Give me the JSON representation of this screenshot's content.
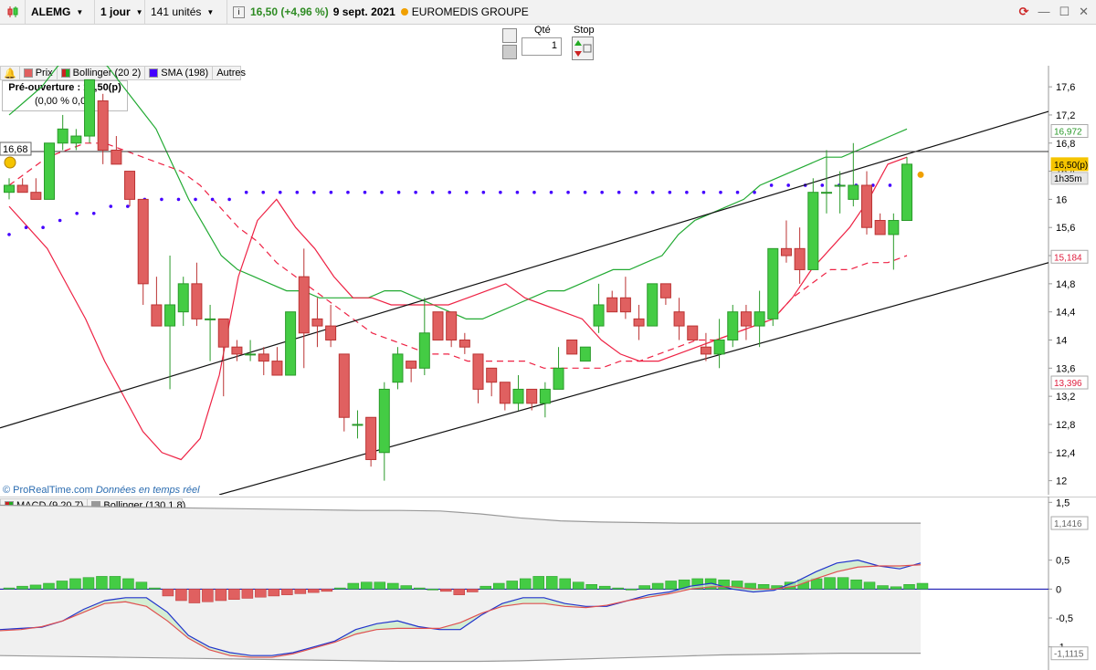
{
  "toolbar": {
    "ticker": "ALEMG",
    "period": "1 jour",
    "units": "141 unités",
    "price_change": "16,50 (+4,96 %)",
    "date": "9 sept. 2021",
    "company": "EUROMEDIS GROUPE"
  },
  "order": {
    "qty_label": "Qté",
    "qty_value": "1",
    "stop_label": "Stop"
  },
  "legend": {
    "prix": "Prix",
    "bollinger": "Bollinger (20 2)",
    "sma": "SMA (198)",
    "autres": "Autres"
  },
  "preouverture": {
    "line1": "Pré-ouverture : 16,50(p)",
    "line2": "(0,00 %  0,00)"
  },
  "hline_label": "16,68",
  "copyright": {
    "brand": "© ProRealTime.com",
    "note": "Données en temps réel"
  },
  "macd_legend": {
    "macd": "MACD (9 20 7)",
    "bollinger": "Bollinger (130 1.8)"
  },
  "colors": {
    "up": "#44cc44",
    "down": "#e06060",
    "sma": "#4400ff",
    "band": "#ff2244",
    "accent": "#f0c000"
  },
  "chart_data": [
    {
      "type": "candlestick",
      "title": "ALEMG",
      "ylim": [
        11.8,
        17.9
      ],
      "y_ticks": [
        "17,6",
        "17,2",
        "16,8",
        "16,4",
        "16",
        "15,6",
        "15,2",
        "14,8",
        "14,4",
        "14",
        "13,6",
        "13,2",
        "12,8",
        "12,4",
        "12"
      ],
      "price_tags": {
        "last": "16,50(p)",
        "time": "1h35m",
        "bb_upper": "16,972",
        "bb_lower": "15,184",
        "bb_lower_left": "13,396"
      },
      "candles": [
        [
          16.1,
          16.3,
          16.0,
          16.2
        ],
        [
          16.2,
          16.3,
          16.1,
          16.1
        ],
        [
          16.1,
          16.3,
          16.0,
          16.0
        ],
        [
          16.0,
          16.8,
          16.0,
          16.8
        ],
        [
          16.8,
          17.2,
          16.7,
          17.0
        ],
        [
          16.8,
          17.0,
          16.7,
          16.9
        ],
        [
          16.9,
          17.7,
          16.8,
          17.7
        ],
        [
          17.4,
          17.5,
          16.5,
          16.7
        ],
        [
          16.7,
          16.9,
          16.5,
          16.5
        ],
        [
          16.4,
          16.4,
          15.9,
          16.0
        ],
        [
          16.0,
          16.0,
          14.5,
          14.8
        ],
        [
          14.5,
          14.9,
          14.2,
          14.2
        ],
        [
          14.2,
          15.2,
          13.3,
          14.5
        ],
        [
          14.4,
          14.9,
          14.2,
          14.8
        ],
        [
          14.8,
          15.1,
          14.2,
          14.3
        ],
        [
          14.3,
          14.5,
          13.7,
          14.3
        ],
        [
          14.3,
          14.3,
          13.2,
          13.9
        ],
        [
          13.9,
          14.0,
          13.7,
          13.8
        ],
        [
          13.8,
          14.0,
          13.7,
          13.8
        ],
        [
          13.8,
          13.9,
          13.5,
          13.7
        ],
        [
          13.7,
          13.9,
          13.5,
          13.5
        ],
        [
          13.5,
          14.4,
          13.5,
          14.4
        ],
        [
          14.9,
          15.3,
          13.6,
          14.1
        ],
        [
          14.3,
          14.6,
          13.9,
          14.2
        ],
        [
          14.2,
          14.5,
          13.9,
          14.0
        ],
        [
          13.8,
          13.8,
          12.7,
          12.9
        ],
        [
          12.8,
          13.0,
          12.6,
          12.8
        ],
        [
          12.9,
          12.9,
          12.2,
          12.3
        ],
        [
          12.4,
          13.4,
          12.0,
          13.3
        ],
        [
          13.4,
          13.9,
          13.3,
          13.8
        ],
        [
          13.7,
          13.7,
          13.4,
          13.6
        ],
        [
          13.6,
          14.6,
          13.5,
          14.1
        ],
        [
          14.4,
          14.4,
          14.0,
          14.0
        ],
        [
          14.4,
          14.4,
          13.9,
          14.0
        ],
        [
          14.0,
          14.1,
          13.8,
          13.9
        ],
        [
          13.8,
          13.8,
          13.1,
          13.3
        ],
        [
          13.6,
          13.6,
          13.2,
          13.4
        ],
        [
          13.4,
          13.4,
          13.0,
          13.1
        ],
        [
          13.1,
          13.5,
          13.0,
          13.3
        ],
        [
          13.3,
          13.3,
          13.0,
          13.1
        ],
        [
          13.1,
          13.4,
          12.9,
          13.3
        ],
        [
          13.3,
          13.9,
          13.3,
          13.6
        ],
        [
          14.0,
          14.0,
          13.8,
          13.8
        ],
        [
          13.7,
          13.9,
          13.7,
          13.9
        ],
        [
          14.2,
          14.8,
          14.1,
          14.5
        ],
        [
          14.6,
          14.7,
          14.4,
          14.4
        ],
        [
          14.6,
          14.9,
          14.3,
          14.4
        ],
        [
          14.3,
          14.5,
          14.0,
          14.2
        ],
        [
          14.2,
          14.8,
          14.2,
          14.8
        ],
        [
          14.8,
          14.8,
          14.5,
          14.6
        ],
        [
          14.4,
          14.6,
          14.0,
          14.2
        ],
        [
          14.2,
          14.2,
          14.0,
          14.0
        ],
        [
          13.9,
          14.1,
          13.7,
          13.8
        ],
        [
          13.8,
          14.3,
          13.6,
          14.0
        ],
        [
          14.0,
          14.5,
          13.9,
          14.4
        ],
        [
          14.4,
          14.5,
          14.0,
          14.2
        ],
        [
          14.2,
          14.7,
          13.9,
          14.4
        ],
        [
          14.3,
          15.3,
          14.2,
          15.3
        ],
        [
          15.3,
          15.7,
          15.1,
          15.2
        ],
        [
          15.3,
          15.6,
          14.8,
          15.0
        ],
        [
          15.0,
          16.3,
          15.0,
          16.1
        ],
        [
          16.1,
          16.7,
          15.8,
          16.1
        ],
        [
          16.2,
          16.4,
          15.8,
          16.2
        ],
        [
          16.0,
          16.8,
          15.9,
          16.2
        ],
        [
          16.2,
          16.4,
          15.5,
          15.6
        ],
        [
          15.7,
          15.8,
          15.5,
          15.5
        ],
        [
          15.5,
          15.8,
          15.0,
          15.7
        ],
        [
          15.7,
          16.6,
          15.8,
          16.5
        ]
      ],
      "bb_upper_line": [
        17.2,
        17.4,
        17.6,
        17.9,
        18.0,
        18.0,
        17.9,
        17.6,
        17.3,
        17.0,
        16.5,
        16.0,
        15.6,
        15.2,
        15.0,
        14.9,
        14.8,
        14.7,
        14.7,
        14.6,
        14.6,
        14.6,
        14.6,
        14.7,
        14.7,
        14.6,
        14.5,
        14.4,
        14.3,
        14.3,
        14.4,
        14.5,
        14.6,
        14.7,
        14.7,
        14.8,
        14.9,
        15.0,
        15.0,
        15.1,
        15.2,
        15.5,
        15.7,
        15.8,
        15.9,
        16.0,
        16.2,
        16.3,
        16.4,
        16.5,
        16.6,
        16.6,
        16.7,
        16.8,
        16.9,
        17.0
      ],
      "bb_mid_line": [
        16.2,
        16.4,
        16.6,
        16.7,
        16.8,
        16.8,
        16.7,
        16.6,
        16.5,
        16.4,
        16.2,
        15.9,
        15.6,
        15.4,
        15.1,
        14.9,
        14.7,
        14.5,
        14.3,
        14.1,
        14.0,
        13.9,
        13.8,
        13.8,
        13.7,
        13.7,
        13.7,
        13.7,
        13.6,
        13.6,
        13.6,
        13.6,
        13.7,
        13.7,
        13.8,
        13.9,
        14.0,
        14.0,
        14.1,
        14.2,
        14.3,
        14.6,
        14.8,
        15.0,
        15.0,
        15.1,
        15.1,
        15.2
      ],
      "sma_line": [
        15.5,
        15.6,
        15.6,
        15.7,
        15.8,
        15.8,
        15.9,
        15.9,
        16.0,
        16.0,
        16.0,
        16.0,
        16.0,
        16.0,
        16.1,
        16.1,
        16.1,
        16.1,
        16.1,
        16.1,
        16.1,
        16.1,
        16.1,
        16.1,
        16.1,
        16.1,
        16.1,
        16.1,
        16.1,
        16.1,
        16.1,
        16.1,
        16.1,
        16.1,
        16.1,
        16.1,
        16.1,
        16.1,
        16.1,
        16.1,
        16.1,
        16.1,
        16.1,
        16.1,
        16.1,
        16.2,
        16.2,
        16.2,
        16.2,
        16.2,
        16.2,
        16.2,
        16.2,
        16.2
      ],
      "hline": 16.68
    },
    {
      "type": "macd",
      "title": "MACD (9 20 7)",
      "ylim": [
        -1.4,
        1.6
      ],
      "y_ticks": [
        "1,5",
        "0,5",
        "0",
        "-0,5",
        "-1"
      ],
      "band_upper_tag": "1,1416",
      "band_lower_tag": "-1,1115",
      "histogram": [
        0.02,
        0.05,
        0.07,
        0.1,
        0.14,
        0.18,
        0.2,
        0.22,
        0.22,
        0.18,
        0.12,
        0.02,
        -0.12,
        -0.2,
        -0.24,
        -0.22,
        -0.2,
        -0.18,
        -0.16,
        -0.14,
        -0.12,
        -0.1,
        -0.08,
        -0.06,
        -0.04,
        0.02,
        0.1,
        0.12,
        0.12,
        0.1,
        0.06,
        0.02,
        0.0,
        -0.04,
        -0.1,
        -0.05,
        0.05,
        0.1,
        0.14,
        0.18,
        0.22,
        0.22,
        0.18,
        0.12,
        0.08,
        0.05,
        0.02,
        0.0,
        0.06,
        0.1,
        0.14,
        0.16,
        0.18,
        0.18,
        0.16,
        0.14,
        0.1,
        0.08,
        0.06,
        0.12,
        0.16,
        0.18,
        0.2,
        0.2,
        0.16,
        0.12,
        0.06,
        0.04,
        0.08,
        0.1
      ],
      "macd_line": [
        -0.7,
        -0.68,
        -0.66,
        -0.55,
        -0.35,
        -0.2,
        -0.15,
        -0.15,
        -0.4,
        -0.8,
        -1.0,
        -1.1,
        -1.15,
        -1.15,
        -1.1,
        -1.0,
        -0.9,
        -0.7,
        -0.6,
        -0.55,
        -0.65,
        -0.7,
        -0.7,
        -0.45,
        -0.25,
        -0.15,
        -0.15,
        -0.25,
        -0.3,
        -0.3,
        -0.2,
        -0.1,
        -0.05,
        0.05,
        0.1,
        0.0,
        -0.05,
        -0.02,
        0.12,
        0.3,
        0.45,
        0.5,
        0.4,
        0.35,
        0.45
      ],
      "signal_line": [
        -0.72,
        -0.7,
        -0.65,
        -0.55,
        -0.4,
        -0.25,
        -0.22,
        -0.3,
        -0.55,
        -0.85,
        -1.05,
        -1.15,
        -1.18,
        -1.18,
        -1.12,
        -1.02,
        -0.92,
        -0.78,
        -0.7,
        -0.68,
        -0.68,
        -0.68,
        -0.58,
        -0.42,
        -0.3,
        -0.25,
        -0.25,
        -0.3,
        -0.32,
        -0.28,
        -0.2,
        -0.14,
        -0.08,
        0.0,
        0.04,
        0.04,
        0.0,
        0.0,
        0.05,
        0.18,
        0.3,
        0.38,
        0.4,
        0.4,
        0.42
      ],
      "band_upper": [
        1.45,
        1.44,
        1.43,
        1.42,
        1.41,
        1.4,
        1.39,
        1.38,
        1.37,
        1.36,
        1.36,
        1.35,
        1.3,
        1.23,
        1.18,
        1.16,
        1.15,
        1.14,
        1.14,
        1.14,
        1.14,
        1.14,
        1.14,
        1.14
      ],
      "band_lower": [
        -1.15,
        -1.16,
        -1.17,
        -1.18,
        -1.19,
        -1.2,
        -1.21,
        -1.22,
        -1.23,
        -1.24,
        -1.25,
        -1.25,
        -1.25,
        -1.24,
        -1.22,
        -1.2,
        -1.18,
        -1.16,
        -1.14,
        -1.13,
        -1.12,
        -1.11,
        -1.11,
        -1.11
      ]
    }
  ]
}
